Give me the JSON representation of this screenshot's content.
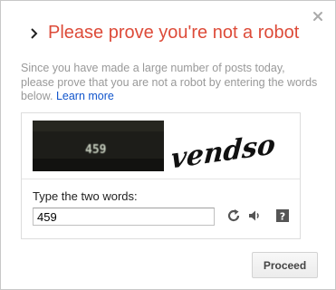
{
  "dialog": {
    "title": "Please prove you're not a robot",
    "description": "Since you have made a large number of posts today, please prove that you are not a robot by entering the words below.",
    "learn_more": "Learn more",
    "close_icon": "close-icon",
    "title_icon": "chevron-right-icon"
  },
  "captcha": {
    "word1": "459",
    "word2": "vendso",
    "prompt": "Type the two words:",
    "answer_value": "459",
    "reload_icon": "reload-icon",
    "audio_icon": "audio-icon",
    "help_icon": "help-icon"
  },
  "actions": {
    "proceed_label": "Proceed"
  },
  "colors": {
    "title": "#dd4b39",
    "link": "#1155cc",
    "muted_text": "#999999"
  }
}
